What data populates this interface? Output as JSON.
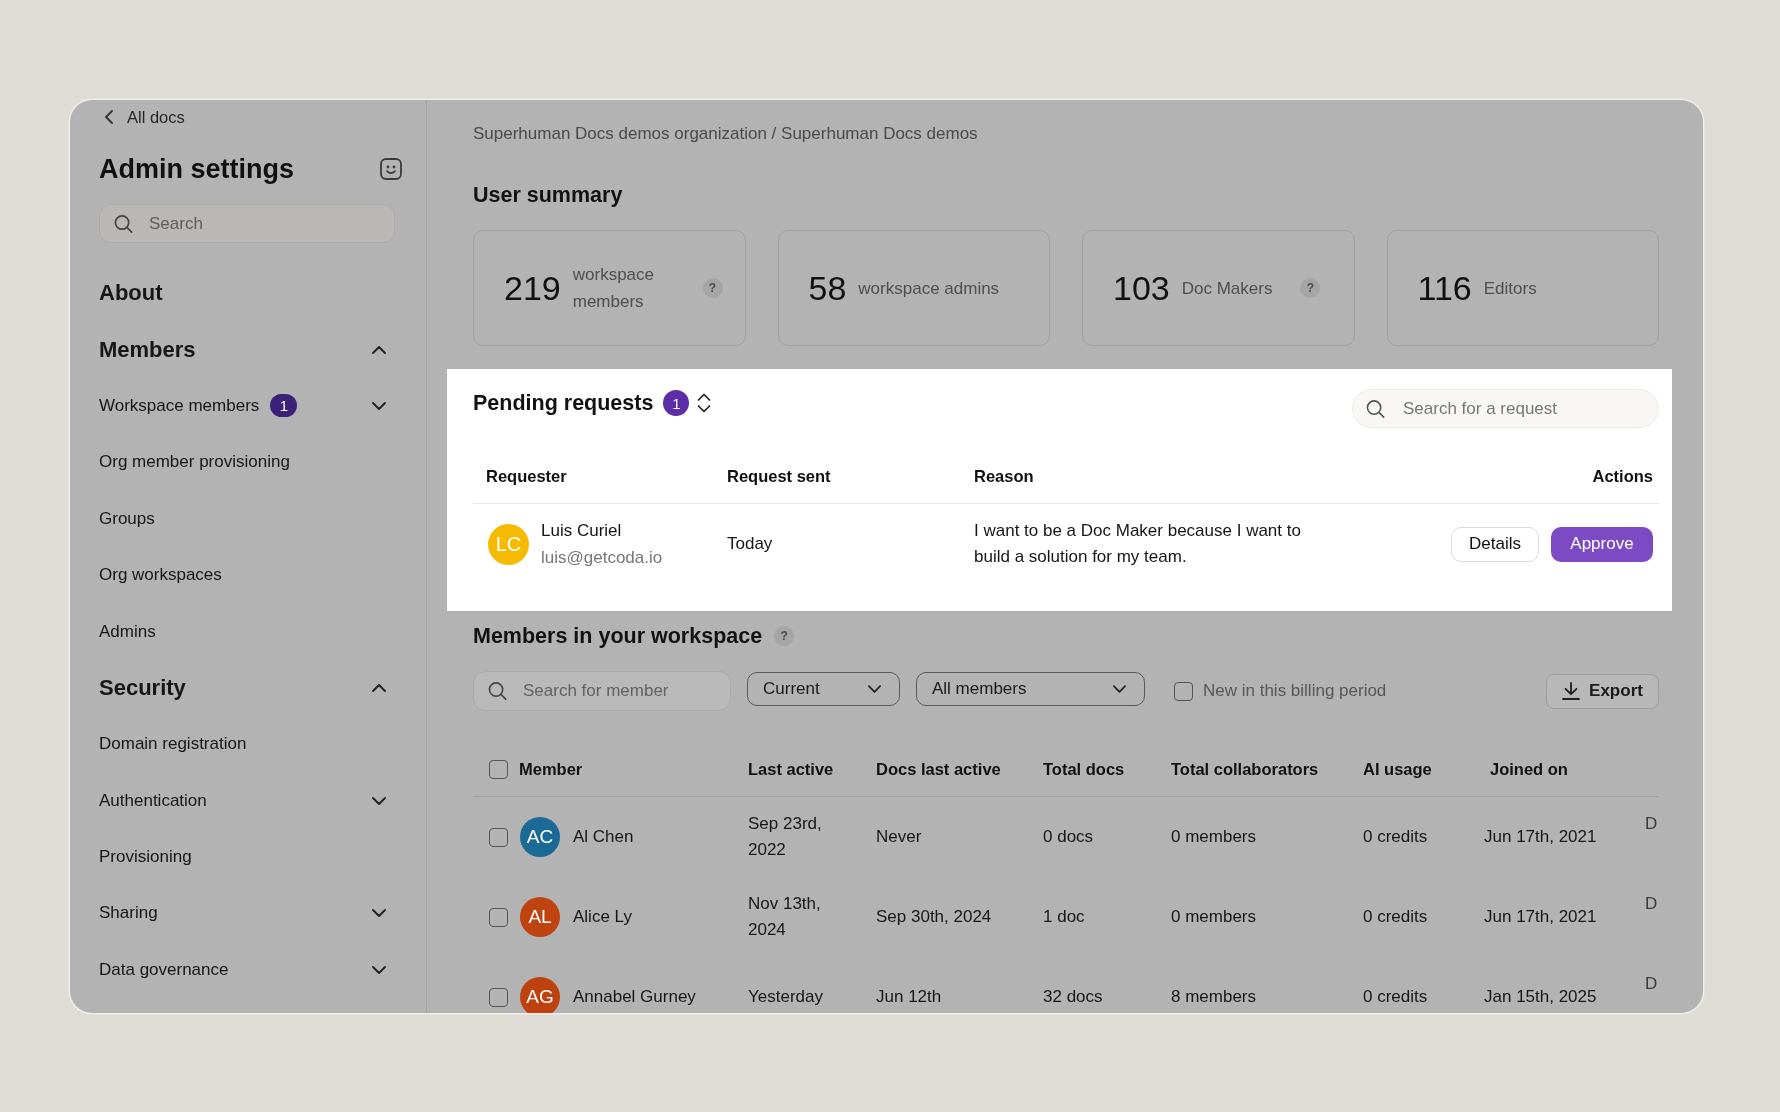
{
  "sidebar": {
    "back_link": "All docs",
    "title": "Admin settings",
    "search": {
      "placeholder": "Search"
    },
    "nav": [
      {
        "kind": "link",
        "label": "About"
      },
      {
        "kind": "section",
        "label": "Members",
        "expanded": true,
        "children": [
          {
            "kind": "expandable",
            "label": "Workspace members",
            "badge": "1",
            "expanded": false
          },
          {
            "kind": "link",
            "label": "Org member provisioning"
          },
          {
            "kind": "link",
            "label": "Groups"
          },
          {
            "kind": "link",
            "label": "Org workspaces"
          },
          {
            "kind": "link",
            "label": "Admins"
          }
        ]
      },
      {
        "kind": "section",
        "label": "Security",
        "expanded": true,
        "children": [
          {
            "kind": "link",
            "label": "Domain registration"
          },
          {
            "kind": "expandable",
            "label": "Authentication",
            "expanded": false
          },
          {
            "kind": "link",
            "label": "Provisioning"
          },
          {
            "kind": "expandable",
            "label": "Sharing",
            "expanded": false
          },
          {
            "kind": "expandable",
            "label": "Data governance",
            "expanded": false
          }
        ]
      }
    ]
  },
  "breadcrumb": "Superhuman Docs demos organization / Superhuman Docs demos",
  "user_summary": {
    "title": "User summary",
    "cards": [
      {
        "value": "219",
        "label": "workspace members",
        "help": "?"
      },
      {
        "value": "58",
        "label": "workspace admins"
      },
      {
        "value": "103",
        "label": "Doc Makers",
        "help": "?"
      },
      {
        "value": "116",
        "label": "Editors"
      }
    ]
  },
  "pending_requests": {
    "title": "Pending requests",
    "count": "1",
    "search": {
      "placeholder": "Search for a request"
    },
    "columns": [
      "Requester",
      "Request sent",
      "Reason",
      "Actions"
    ],
    "rows": [
      {
        "initials": "LC",
        "color": "#f6bb00",
        "name": "Luis Curiel",
        "email": "luis@getcoda.io",
        "sent": "Today",
        "reason": "I want to be a Doc Maker because I want to build a solution for my team.",
        "actions": [
          {
            "kind": "secondary",
            "label": "Details"
          },
          {
            "kind": "primary",
            "label": "Approve"
          }
        ]
      }
    ]
  },
  "members": {
    "title": "Members in your workspace",
    "help": "?",
    "search": {
      "placeholder": "Search for member"
    },
    "filters": [
      "Current",
      "All members"
    ],
    "billing_filter": {
      "label": "New in this billing period",
      "checked": false
    },
    "export_label": "Export",
    "select_all_checked": false,
    "columns": [
      "Member",
      "Last active",
      "Docs last active",
      "Total docs",
      "Total collaborators",
      "AI usage",
      "Joined on"
    ],
    "rows": [
      {
        "checked": false,
        "initials": "AC",
        "color": "#1b6995",
        "name": "Al Chen",
        "last_active": "Sep 23rd, 2022",
        "docs_last_active": "Never",
        "total_docs": "0 docs",
        "total_collaborators": "0 members",
        "ai_usage": "0 credits",
        "joined_on": "Jun 17th, 2021",
        "column_8": "D"
      },
      {
        "checked": false,
        "initials": "AL",
        "color": "#bf430e",
        "name": "Alice Ly",
        "last_active": "Nov 13th, 2024",
        "docs_last_active": "Sep 30th, 2024",
        "total_docs": "1 doc",
        "total_collaborators": "0 members",
        "ai_usage": "0 credits",
        "joined_on": "Jun 17th, 2021",
        "column_8": "D"
      },
      {
        "checked": false,
        "initials": "AG",
        "color": "#bf410e",
        "name": "Annabel Gurney",
        "last_active": "Yesterday",
        "docs_last_active": "Jun 12th",
        "total_docs": "32 docs",
        "total_collaborators": "8 members",
        "ai_usage": "0 credits",
        "joined_on": "Jan 15th, 2025",
        "column_8": "D"
      }
    ]
  }
}
